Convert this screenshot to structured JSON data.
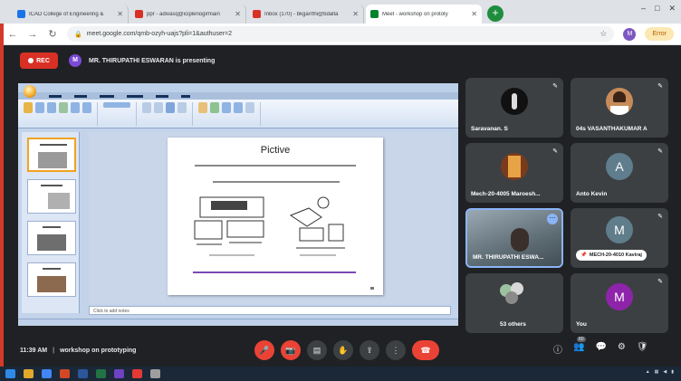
{
  "browser": {
    "tabs": [
      {
        "title": "ICAD College of Engineering &",
        "icon": "college-favicon",
        "color": "#1a73e8",
        "active": false
      },
      {
        "title": "ppr - adivasq@iciplenogirmain",
        "icon": "gmail-favicon",
        "color": "#d93025",
        "active": false
      },
      {
        "title": "Inbox (170) - bkgarrthi@bdalta",
        "icon": "gmail-favicon",
        "color": "#d93025",
        "active": false
      },
      {
        "title": "Meet - workshop on prototy",
        "icon": "meet-favicon",
        "color": "#00832d",
        "active": true
      }
    ],
    "new_tab": "+",
    "window_controls": [
      "–",
      "□",
      "✕"
    ],
    "url": "meet.google.com/qmb-ozyh-uajs?pli=1&authuser=2",
    "error_label": "Error",
    "profile_initial": "M"
  },
  "meet": {
    "rec_label": "REC",
    "presenter_initial": "M",
    "presenter_text": "MR. THIRUPATHI ESWARAN is presenting",
    "slide": {
      "title": "Pictive",
      "notes_placeholder": "Click to add notes"
    },
    "participants": [
      {
        "name": "Saravanan. S",
        "kind": "photo",
        "color": "#222"
      },
      {
        "name": "04s VASANTHAKUMAR A",
        "kind": "photo",
        "color": "#c78b5a"
      },
      {
        "name": "Mech-20-4005 Maroesh...",
        "kind": "photo",
        "color": "#c6762e"
      },
      {
        "name": "Anto Kevin",
        "kind": "initial",
        "initial": "A",
        "color": "#5f7d8c"
      },
      {
        "name": "MR. THIRUPATHI ESWA...",
        "kind": "video",
        "color": "#6b7c8a"
      },
      {
        "name": "MECH-20-4010 Kaviraj",
        "kind": "initial",
        "initial": "M",
        "color": "#607d8b"
      },
      {
        "name": "53 others",
        "kind": "group",
        "color": "#3c4043"
      },
      {
        "name": "You",
        "kind": "initial",
        "initial": "M",
        "color": "#8e24aa"
      }
    ],
    "time": "11:39 AM",
    "separator": "|",
    "meeting_title": "workshop on prototyping",
    "participants_count": "60"
  },
  "colors": {
    "meet_bg": "#202124",
    "tile_bg": "#3c4043",
    "danger": "#ea4335",
    "accent": "#8ab4f8"
  }
}
